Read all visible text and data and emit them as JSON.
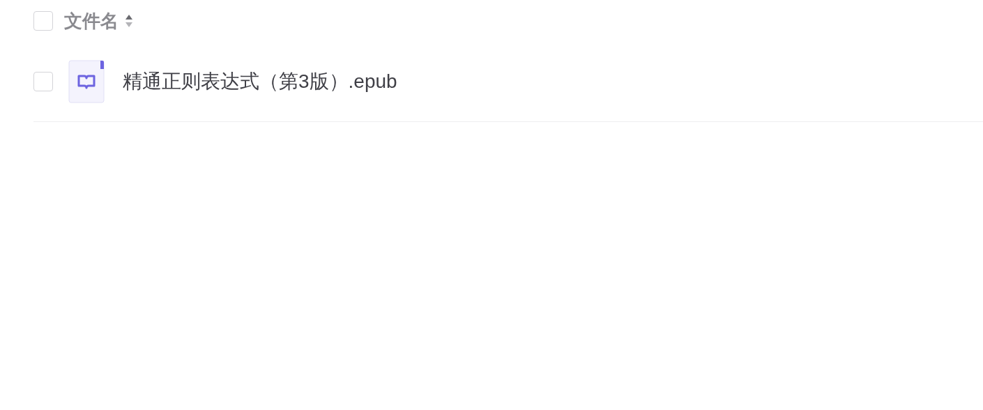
{
  "header": {
    "checked": false,
    "label": "文件名"
  },
  "files": [
    {
      "name": "精通正则表达式（第3版）.epub",
      "checked": false,
      "kind": "book"
    }
  ]
}
